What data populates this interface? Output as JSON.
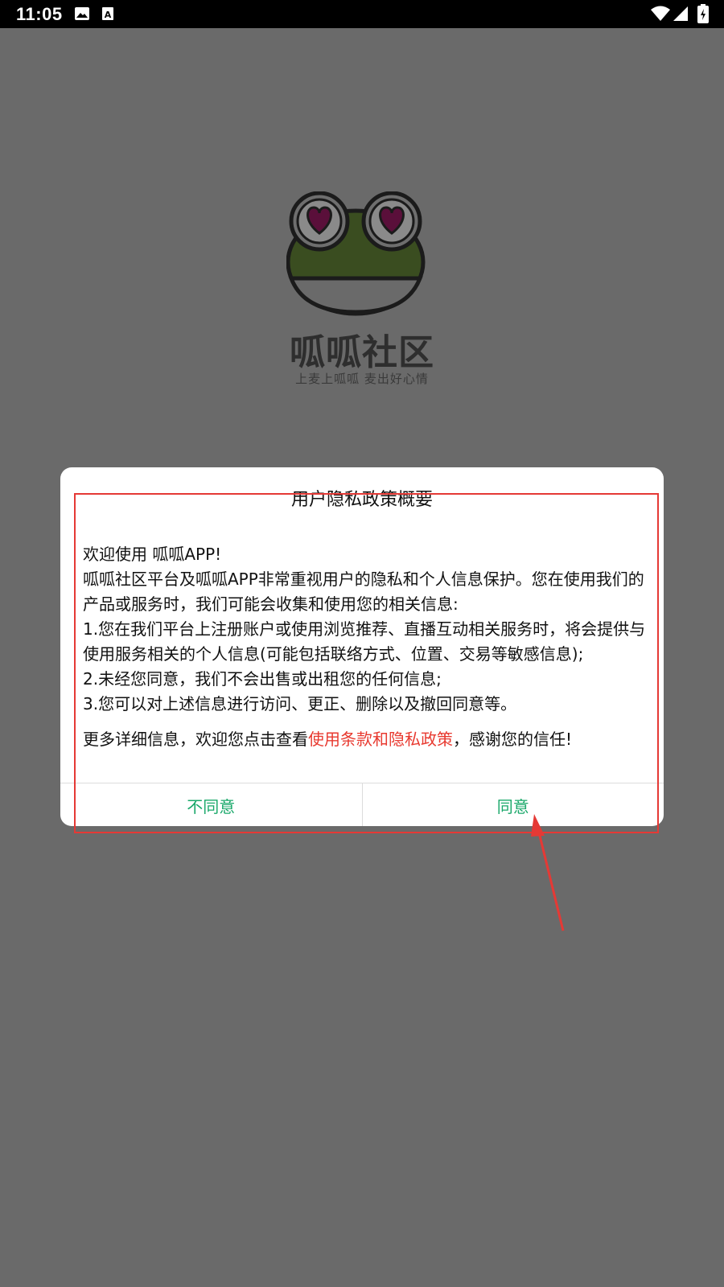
{
  "status_bar": {
    "time": "11:05",
    "left_icons": [
      "image-icon",
      "text-a-icon"
    ],
    "right_icons": [
      "wifi-icon",
      "signal-icon",
      "battery-icon"
    ]
  },
  "splash": {
    "app_name": "呱呱社区",
    "slogan": "上麦上呱呱 麦出好心情",
    "logo": "frog-logo"
  },
  "dialog": {
    "title": "用户隐私政策概要",
    "welcome": "欢迎使用 呱呱APP!",
    "paragraphs": [
      "呱呱社区平台及呱呱APP非常重视用户的隐私和个人信息保护。您在使用我们的产品或服务时，我们可能会收集和使用您的相关信息:",
      "1.您在我们平台上注册账户或使用浏览推荐、直播互动相关服务时，将会提供与使用服务相关的个人信息(可能包括联络方式、位置、交易等敏感信息);",
      "2.未经您同意，我们不会出售或出租您的任何信息;",
      "3.您可以对上述信息进行访问、更正、删除以及撤回同意等。"
    ],
    "more_prefix": "更多详细信息，欢迎您点击查看",
    "more_link": "使用条款和隐私政策",
    "more_suffix": "，感谢您的信任!",
    "disagree_label": "不同意",
    "agree_label": "同意"
  },
  "colors": {
    "overlay": "#6a6a6a",
    "button_text": "#1aa86a",
    "link": "#e8392f",
    "annotation": "#e53935"
  }
}
